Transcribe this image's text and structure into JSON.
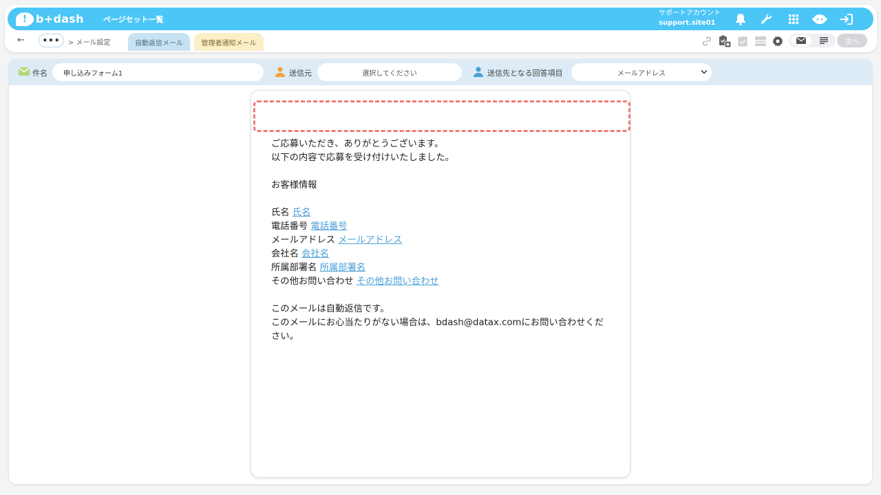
{
  "header": {
    "logo_mark": "!",
    "logo_text": "b+dash",
    "title": "ページセット一覧",
    "account_label": "サポートアカウント",
    "account_id": "support.site01",
    "icons": [
      "bell-icon",
      "wrench-icon",
      "grid-icon",
      "chat-robot-icon",
      "logout-icon"
    ]
  },
  "nav": {
    "back_glyph": "←",
    "more_glyph": "•••",
    "breadcrumb": "> メール設定",
    "tabs": [
      {
        "label": "自動返信メール",
        "active": true
      },
      {
        "label": "管理者通知メール",
        "active": false
      }
    ],
    "tool_icons": [
      "link-icon",
      "clipboard-add-icon",
      "clipboard-check-icon",
      "layout-icon",
      "gear-icon"
    ],
    "next_label": "次へ"
  },
  "fields": {
    "subject_label": "件名",
    "subject_value": "申し込みフォーム1",
    "sender_label": "送信元",
    "sender_placeholder": "選択してください",
    "recipient_label": "送信先となる回答項目",
    "recipient_value": "メールアドレス"
  },
  "email": {
    "greeting_1": "ご応募いただき、ありがとうございます。",
    "greeting_2": "以下の内容で応募を受け付けいたしました。",
    "section_title": "お客様情報",
    "rows": [
      {
        "label": "氏名",
        "var": "氏名"
      },
      {
        "label": "電話番号",
        "var": "電話番号"
      },
      {
        "label": "メールアドレス",
        "var": "メールアドレス"
      },
      {
        "label": "会社名",
        "var": "会社名"
      },
      {
        "label": "所属部署名",
        "var": "所属部署名"
      },
      {
        "label": "その他お問い合わせ",
        "var": "その他お問い合わせ"
      }
    ],
    "footer_1": "このメールは自動返信です。",
    "footer_2": "このメールにお心当たりがない場合は、bdash@datax.comにお問い合わせください。"
  },
  "colors": {
    "brand": "#4cc6f7",
    "field_bar": "#dcebf6",
    "link": "#4a9fd8",
    "highlight_dash": "#ef7b7b"
  }
}
